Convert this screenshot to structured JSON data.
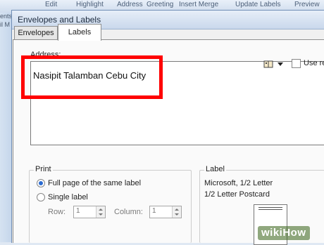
{
  "ribbon": {
    "items": [
      "Edit",
      "Highlight",
      "Address",
      "Greeting",
      "Insert Merge",
      "Update Labels",
      "Preview"
    ],
    "left_items": [
      "ents",
      "il M"
    ]
  },
  "dialog": {
    "title": "Envelopes and Labels",
    "tabs": {
      "envelopes": "Envelopes",
      "labels": "Labels"
    },
    "address_label": "Address:",
    "address_value": "Nasipit Talamban Cebu City",
    "use_return_label": "Use re",
    "print": {
      "title": "Print",
      "full_page": "Full page of the same label",
      "single_label": "Single label",
      "row_label": "Row:",
      "column_label": "Column:",
      "row_value": "1",
      "column_value": "1",
      "selected": "full_page"
    },
    "label": {
      "title": "Label",
      "line1": "Microsoft, 1/2 Letter",
      "line2": "1/2 Letter Postcard"
    }
  },
  "watermark": "wikiHow",
  "colors": {
    "highlight": "#ff0000",
    "dialog_bg": "#f0f0f0"
  },
  "icons": [
    "address-book-icon",
    "chevron-down-icon"
  ]
}
